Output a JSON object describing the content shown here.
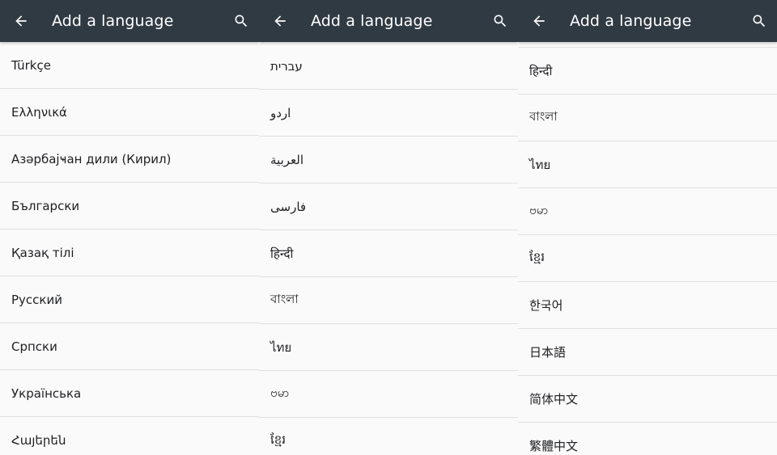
{
  "panels": [
    {
      "header": {
        "title": "Add a language"
      },
      "items": [
        "Türkçe",
        "Ελληνικά",
        "Азәрбајҹан дили (Кирил)",
        "Български",
        "Қазақ тілі",
        "Русский",
        "Српски",
        "Українська",
        "Հայերեն"
      ]
    },
    {
      "header": {
        "title": "Add a language"
      },
      "items": [
        "עברית",
        "اردو",
        "العربية",
        "فارسی",
        "हिन्दी",
        "বাংলা",
        "ไทย",
        "ဗမာ",
        "ខ្មែរ"
      ]
    },
    {
      "header": {
        "title": "Add a language"
      },
      "items": [
        "हिन्दी",
        "বাংলা",
        "ไทย",
        "ဗမာ",
        "ខ្មែរ",
        "한국어",
        "日本語",
        "简体中文",
        "繁體中文"
      ]
    }
  ],
  "icons": {
    "back": "arrow-back-icon",
    "search": "search-icon"
  },
  "colors": {
    "appbar": "#303a43",
    "appbar_text": "#ffffff",
    "list_bg": "#fafafa",
    "divider": "#e0e0e0",
    "item_text": "#202124"
  }
}
